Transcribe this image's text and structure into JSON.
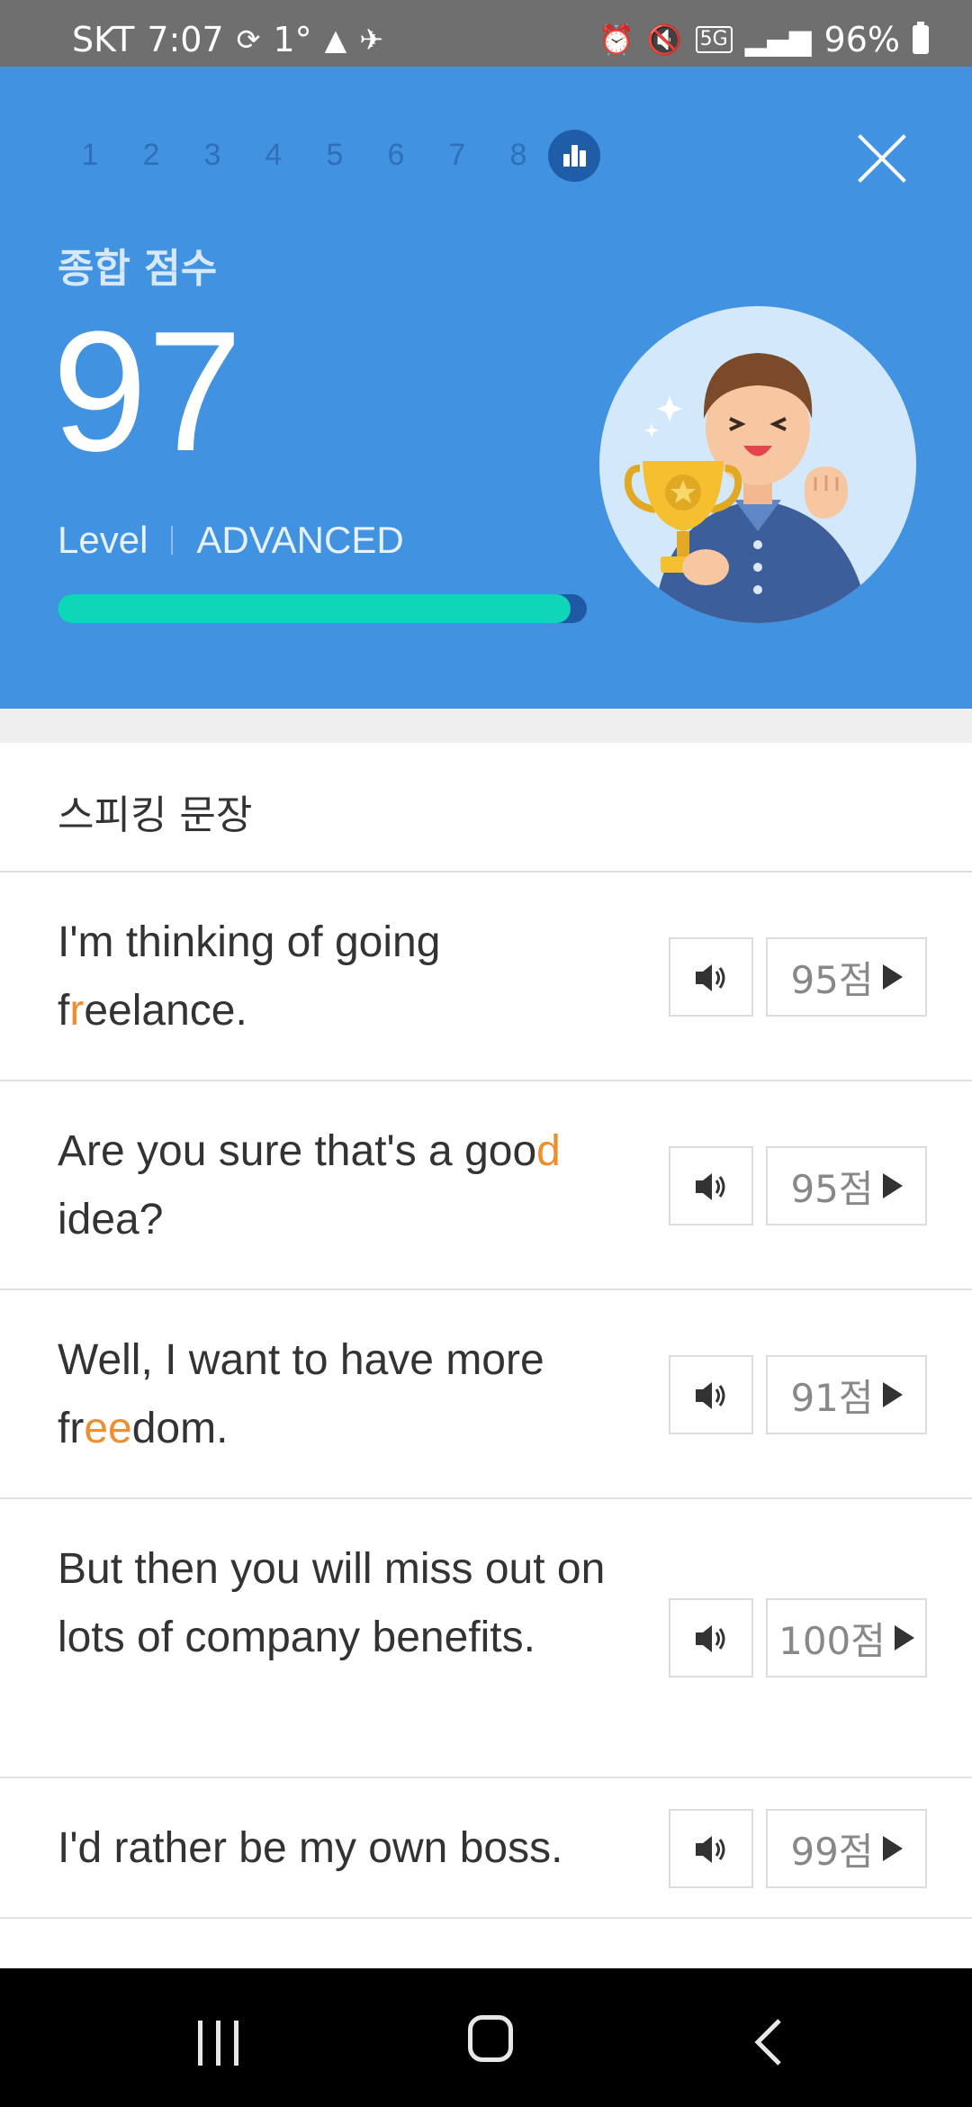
{
  "status_bar": {
    "carrier": "SKT",
    "time": "7:07",
    "temp": "1°",
    "network": "5G",
    "battery": "96%"
  },
  "header": {
    "steps": [
      "1",
      "2",
      "3",
      "4",
      "5",
      "6",
      "7",
      "8"
    ],
    "score_label": "종합 점수",
    "score": "97",
    "level_label": "Level",
    "level_value": "ADVANCED",
    "progress": 0.97,
    "colors": {
      "background": "#4192e0",
      "progress_fill": "#0ed6b8",
      "progress_track": "#1d5aa3"
    }
  },
  "section": {
    "title": "스피킹 문장"
  },
  "sentences": [
    {
      "parts": [
        {
          "t": "I'm thinking of going f"
        },
        {
          "t": "r",
          "hl": true
        },
        {
          "t": "eelance."
        }
      ],
      "score": "95점"
    },
    {
      "parts": [
        {
          "t": "Are you sure that's a goo"
        },
        {
          "t": "d",
          "hl": true
        },
        {
          "t": " idea?"
        }
      ],
      "score": "95점"
    },
    {
      "parts": [
        {
          "t": "Well, I want to have more fr"
        },
        {
          "t": "ee",
          "hl": true
        },
        {
          "t": "dom."
        }
      ],
      "score": "91점"
    },
    {
      "parts": [
        {
          "t": "But then you will miss out on lots of company benefits."
        }
      ],
      "score": "100점"
    },
    {
      "parts": [
        {
          "t": "I'd rather be my own boss."
        }
      ],
      "score": "99점"
    }
  ],
  "accent_color": "#f08d2c"
}
